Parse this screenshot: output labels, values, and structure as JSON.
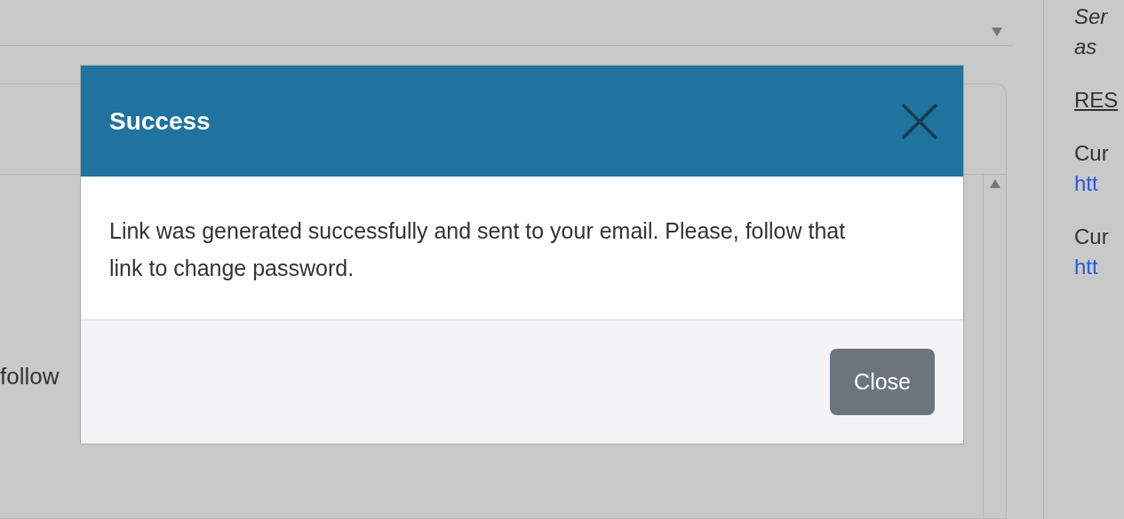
{
  "background": {
    "panel_text": "follow",
    "side_texts": [
      {
        "text": "Ser",
        "kind": "italic"
      },
      {
        "text": "as",
        "kind": "italic"
      },
      {
        "text": "RES",
        "kind": "underlined"
      },
      {
        "text": "Cur",
        "kind": "plain"
      },
      {
        "text": "htt",
        "kind": "link"
      },
      {
        "text": "Cur",
        "kind": "plain"
      },
      {
        "text": "htt",
        "kind": "link"
      }
    ]
  },
  "dialog": {
    "title": "Success",
    "message": "Link was generated successfully and sent to your email. Please, follow that link to change password.",
    "buttons": [
      "Close"
    ]
  }
}
